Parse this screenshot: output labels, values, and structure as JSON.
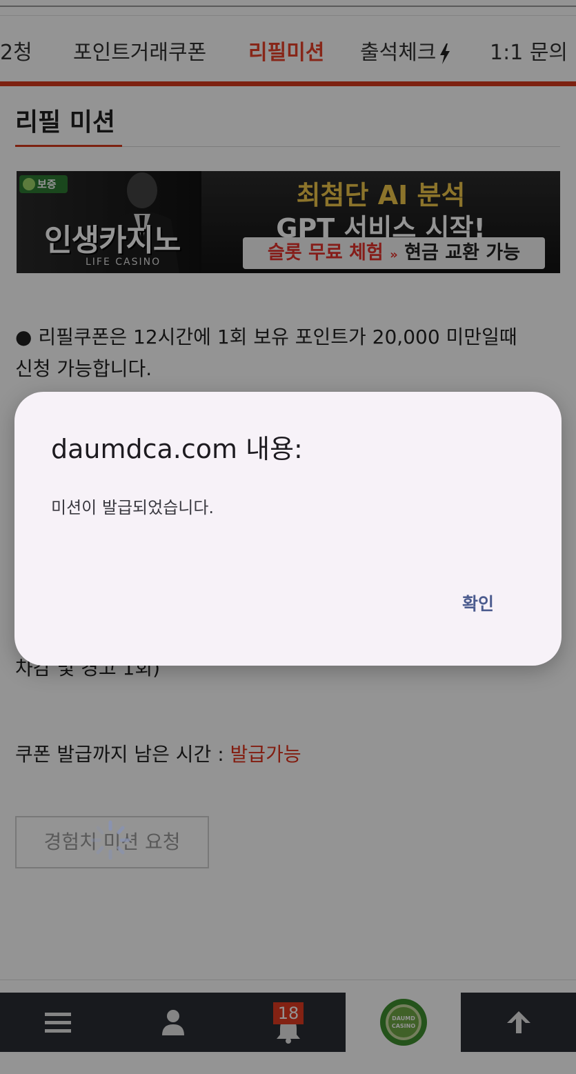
{
  "nav": {
    "tabs": [
      {
        "label": "2청",
        "active": false
      },
      {
        "label": "포인트거래쿠폰",
        "active": false
      },
      {
        "label": "리필미션",
        "active": true
      },
      {
        "label": "출석체크",
        "active": false
      },
      {
        "label": "1:1 문의",
        "active": false
      }
    ]
  },
  "section": {
    "title": "리필 미션"
  },
  "banner": {
    "badge": "보증",
    "brand": "인생카지노",
    "brand_sub": "LIFE CASINO",
    "headline1": "최첨단 AI 분석",
    "headline2": "GPT 서비스 시작!",
    "pill_red": "슬롯 무료 체험",
    "pill_arrow": "»",
    "pill_dark": "현금 교환 가능"
  },
  "content": {
    "line1": "● 리필쿠폰은 12시간에 1회 보유 포인트가 20,000 미만일때",
    "line2": "신청 가능합니다.",
    "line_partial": "차감 및 경고 1회)",
    "remaining_label": "쿠폰 발급까지 남은 시간 : ",
    "remaining_value": "발급가능",
    "request_button": "경험치 미션 요청"
  },
  "bottom_bar": {
    "notification_count": "18",
    "logo_text_top": "DAUMD",
    "logo_text_bottom": "CASINO",
    "colors": {
      "bar": "#2a2e35",
      "badge": "#e23b21",
      "accent": "#d83a1c"
    }
  },
  "dialog": {
    "title": "daumdca.com 내용:",
    "message": "미션이 발급되었습니다.",
    "confirm_label": "확인"
  }
}
